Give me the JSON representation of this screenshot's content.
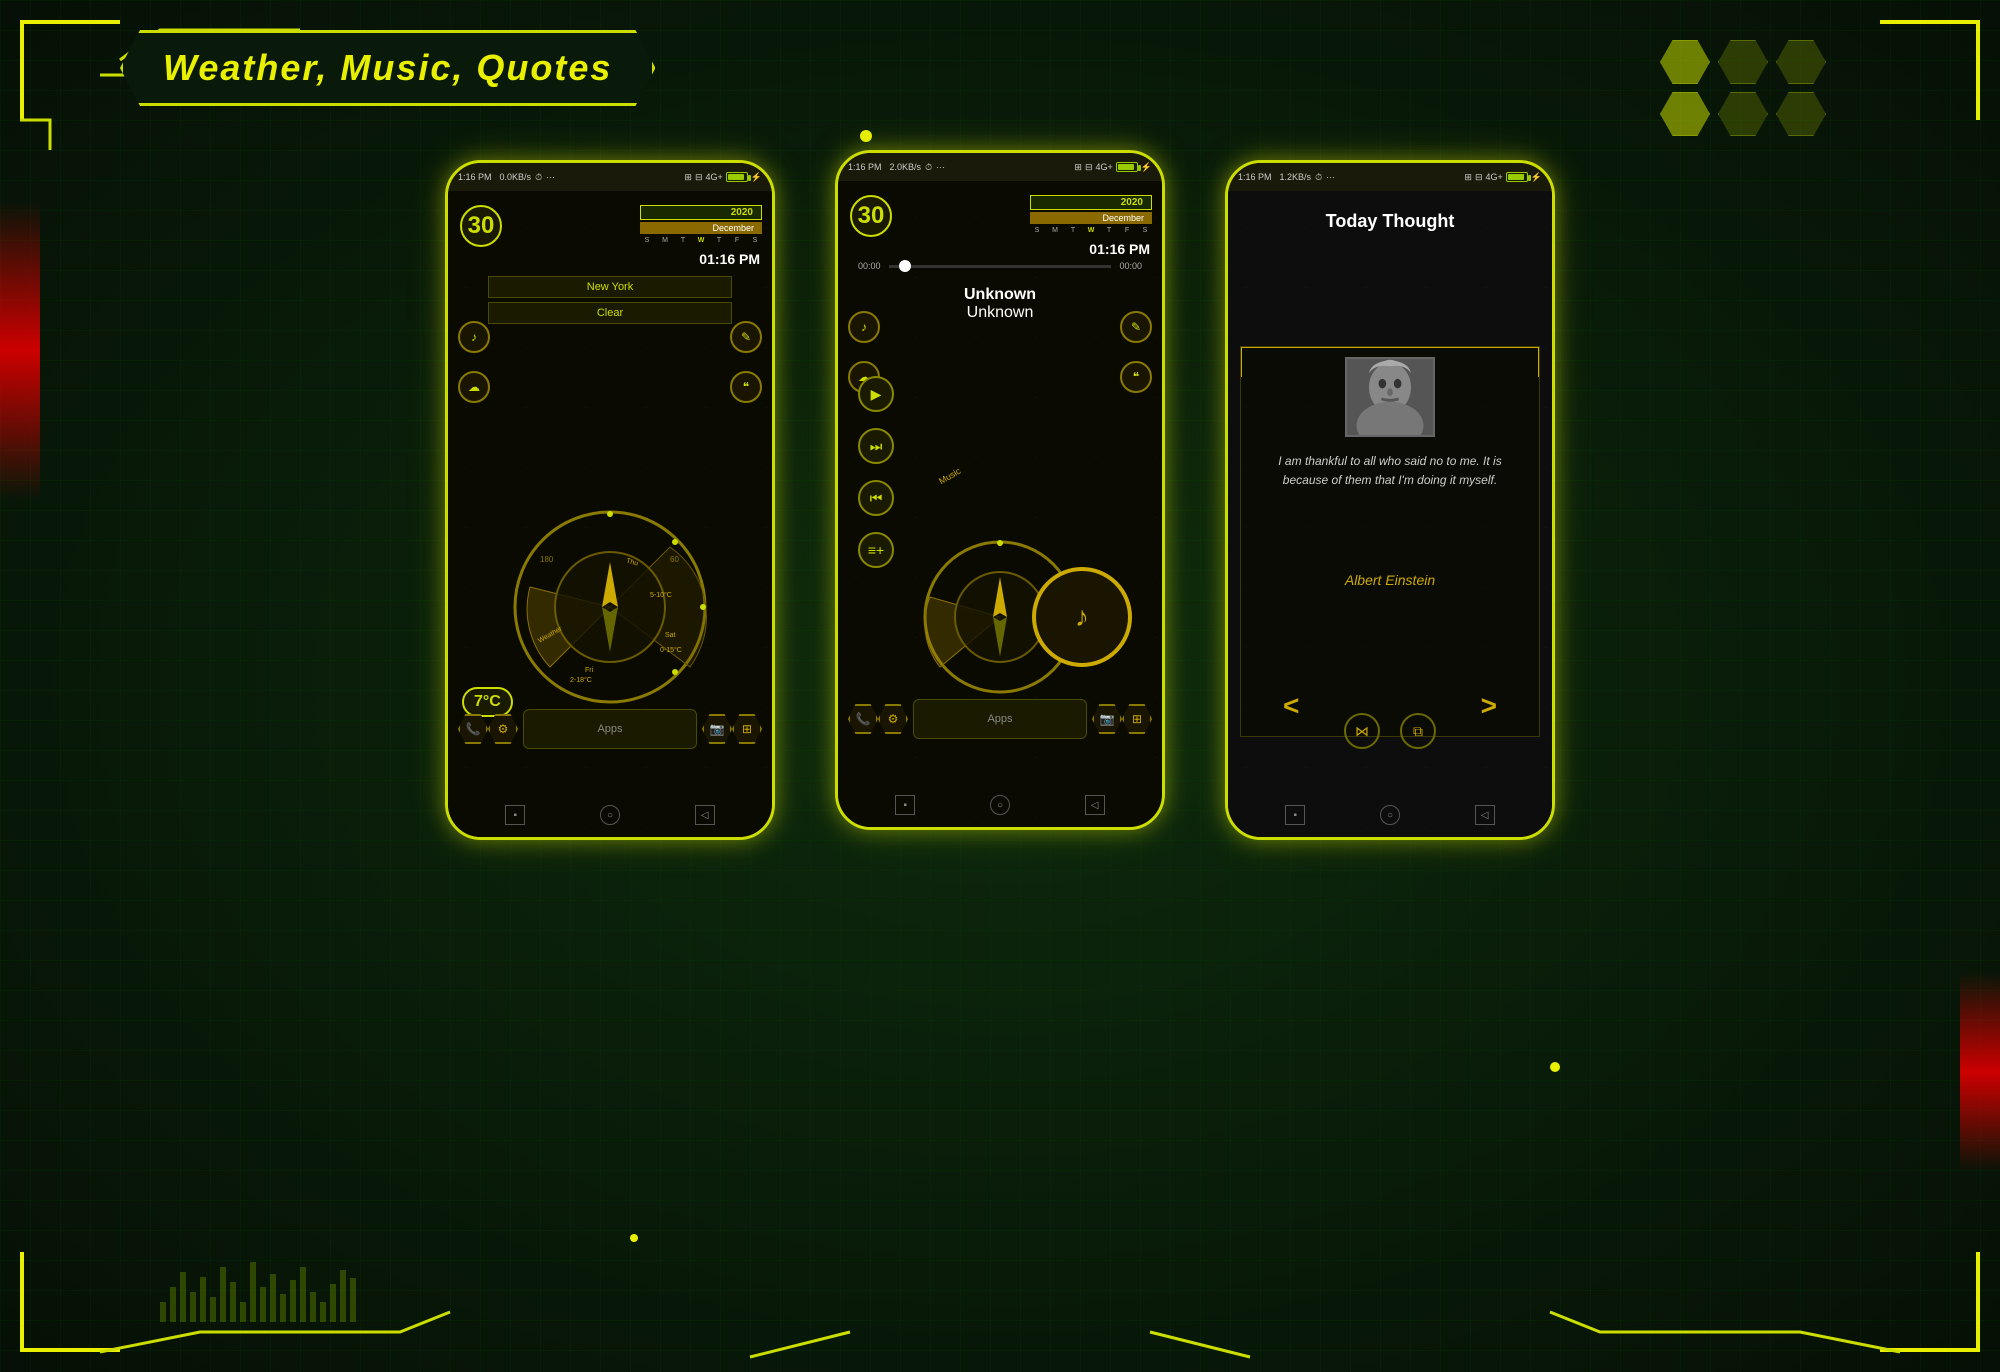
{
  "app": {
    "title": "Weather, Music, Quotes",
    "background_color": "#0a1a0a"
  },
  "phone1": {
    "type": "weather",
    "status_bar": {
      "time": "1:16 PM",
      "data_speed": "0.0KB/s",
      "battery_label": "4G+"
    },
    "calendar": {
      "year": "2020",
      "month": "December",
      "days": [
        "S",
        "M",
        "T",
        "W",
        "T",
        "F",
        "S"
      ],
      "current_day": "30",
      "time": "01:16 PM"
    },
    "weather": {
      "location": "New York",
      "condition": "Clear",
      "temperature": "7°C",
      "forecast": [
        {
          "day": "Thu",
          "range": "5-10°C"
        },
        {
          "day": "Fri",
          "range": "2-18°C"
        },
        {
          "day": "Sat",
          "range": "0-15°C"
        }
      ]
    },
    "nav": {
      "apps_label": "Apps"
    }
  },
  "phone2": {
    "type": "music",
    "status_bar": {
      "time": "1:16 PM",
      "data_speed": "2.0KB/s",
      "battery_label": "4G+"
    },
    "calendar": {
      "year": "2020",
      "month": "December",
      "days": [
        "S",
        "M",
        "T",
        "W",
        "T",
        "F",
        "S"
      ],
      "current_day": "30",
      "time": "01:16 PM"
    },
    "player": {
      "current_time": "00:00",
      "total_time": "00:00",
      "song_title": "Unknown",
      "artist": "Unknown"
    },
    "nav": {
      "apps_label": "Apps"
    }
  },
  "phone3": {
    "type": "quotes",
    "status_bar": {
      "time": "1:16 PM",
      "data_speed": "1.2KB/s",
      "battery_label": "4G+"
    },
    "quote": {
      "title": "Today Thought",
      "author_photo_alt": "Albert Einstein",
      "text": "I am thankful to all who said no to me. It is because of them that I'm doing it myself.",
      "author": "Albert Einstein"
    }
  }
}
